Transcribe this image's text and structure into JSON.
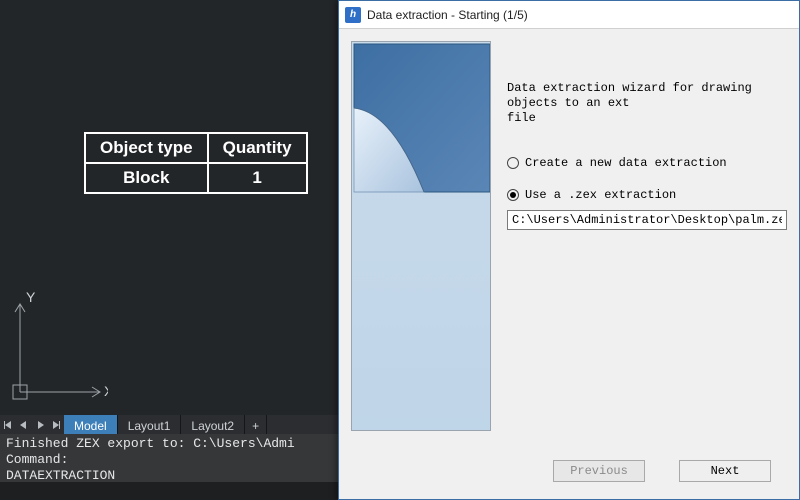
{
  "canvas": {
    "table": {
      "headers": [
        "Object type",
        "Quantity"
      ],
      "rows": [
        [
          "Block",
          "1"
        ]
      ]
    },
    "ucs_labels": {
      "x": "X",
      "y": "Y"
    }
  },
  "layout_tabs": {
    "items": [
      {
        "label": "Model",
        "active": true
      },
      {
        "label": "Layout1",
        "active": false
      },
      {
        "label": "Layout2",
        "active": false
      }
    ],
    "plus_label": "+"
  },
  "command_panel": {
    "lines": [
      "Finished ZEX export to: C:\\Users\\Admi",
      "Command:",
      "DATAEXTRACTION"
    ]
  },
  "dialog": {
    "title": "Data extraction - Starting (1/5)",
    "intro": "Data extraction wizard for drawing objects to an ext\nfile",
    "option_new": "Create a new data extraction",
    "option_use": "Use a .zex extraction",
    "selected_option": "use",
    "path": "C:\\Users\\Administrator\\Desktop\\palm.zex",
    "buttons": {
      "prev": "Previous",
      "next": "Next"
    },
    "prev_enabled": false,
    "next_enabled": true
  }
}
